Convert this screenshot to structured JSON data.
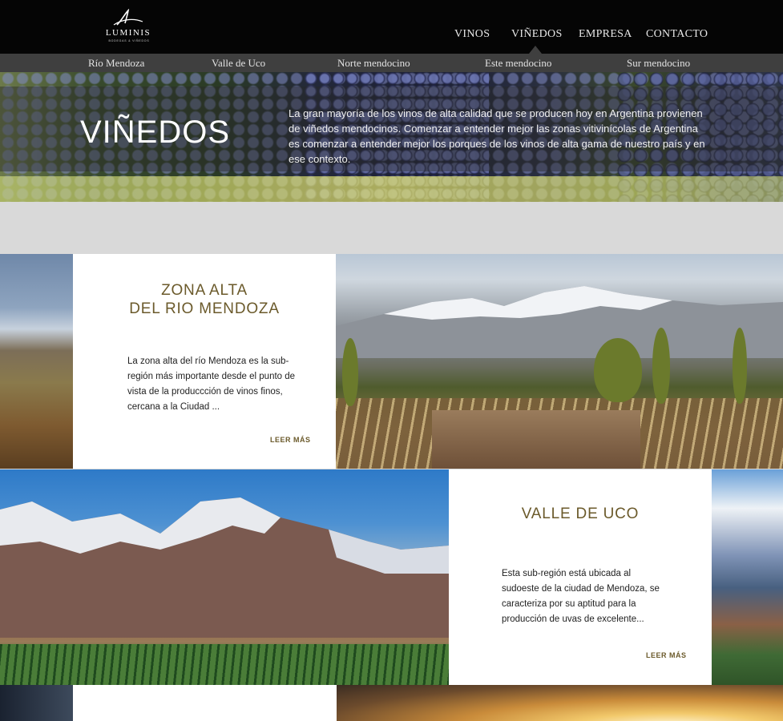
{
  "header": {
    "logo_text": "LUMINIS",
    "logo_sub": "BODEGAS & VIÑEDOS",
    "nav": [
      {
        "label": "VINOS"
      },
      {
        "label": "VIÑEDOS"
      },
      {
        "label": "EMPRESA"
      },
      {
        "label": "CONTACTO"
      }
    ],
    "active_nav": "VIÑEDOS"
  },
  "subnav": [
    {
      "label": "Río Mendoza"
    },
    {
      "label": "Valle de Uco"
    },
    {
      "label": "Norte mendocino"
    },
    {
      "label": "Este mendocino"
    },
    {
      "label": "Sur mendocino"
    }
  ],
  "hero": {
    "title": "VIÑEDOS",
    "text": "La gran mayoría de los vinos de alta calidad que se producen hoy en Argentina provienen de viñedos mendocinos. Comenzar a entender mejor las zonas vitivinícolas de Argentina es comenzar a entender mejor los porques de los vinos de alta gama de nuestro país y en ese contexto."
  },
  "regions": [
    {
      "title_line1": "ZONA ALTA",
      "title_line2": "DEL RIO MENDOZA",
      "text": "La zona alta del río Mendoza es la sub-región más importante desde el punto de vista de la produccción de vinos finos, cercana a la Ciudad ...",
      "more": "LEER MÁS"
    },
    {
      "title_line1": "VALLE DE UCO",
      "text": "Esta sub-región está ubicada al sudoeste de la ciudad de Mendoza, se caracteriza por su aptitud para la producción de uvas de excelente...",
      "more": "LEER MÁS"
    }
  ],
  "colors": {
    "header_bg": "#050505",
    "subnav_bg": "#3f3f3f",
    "accent_gold": "#6b5a2b",
    "page_bg": "#d9d9d9"
  }
}
